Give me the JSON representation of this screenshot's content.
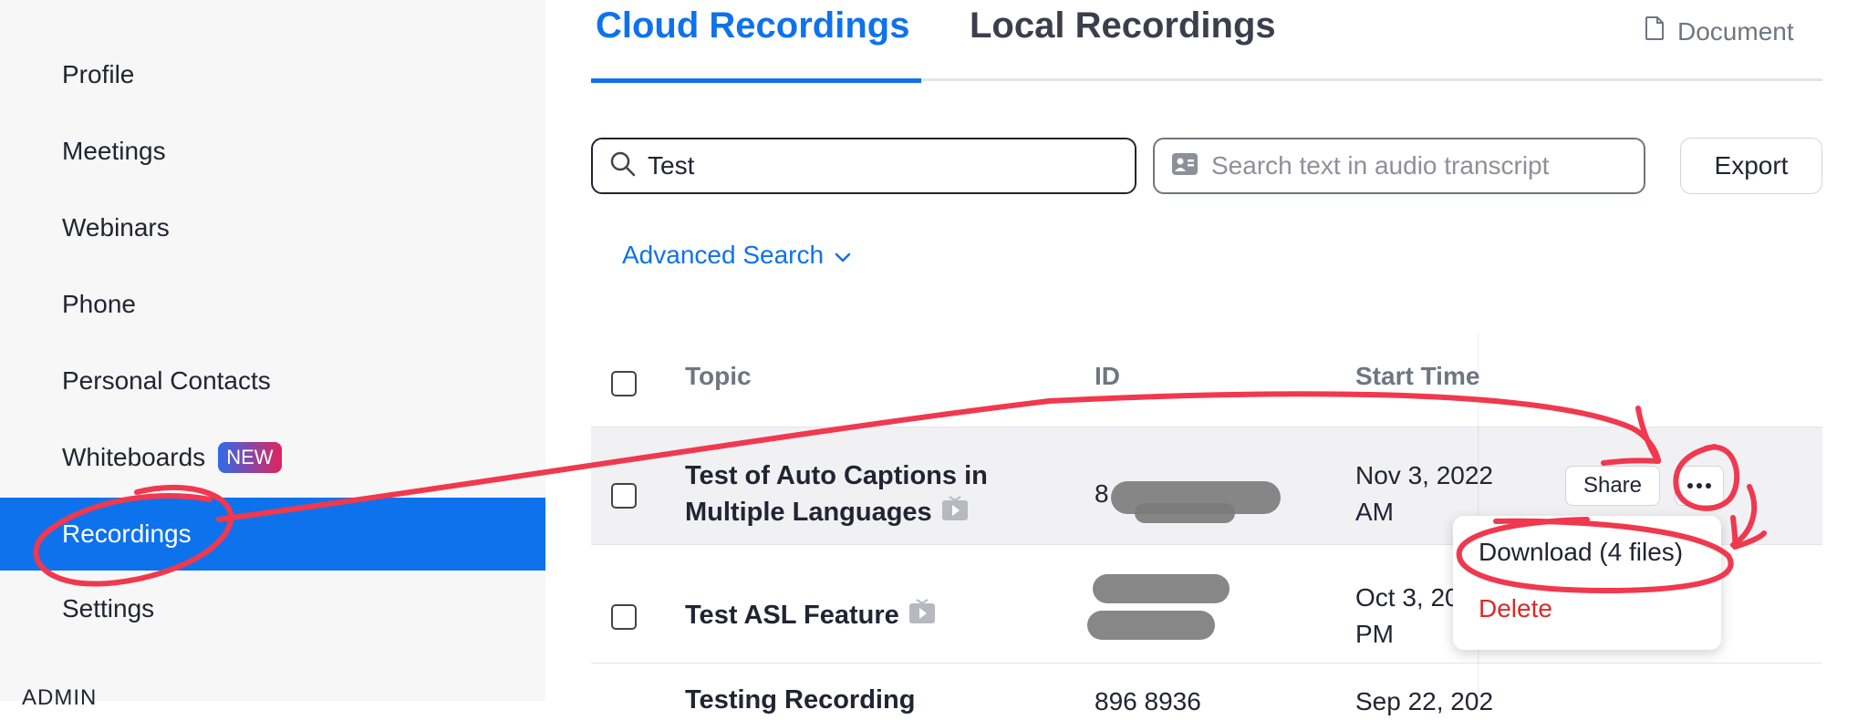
{
  "sidebar": {
    "items": [
      {
        "label": "Profile"
      },
      {
        "label": "Meetings"
      },
      {
        "label": "Webinars"
      },
      {
        "label": "Phone"
      },
      {
        "label": "Personal Contacts"
      },
      {
        "label": "Whiteboards",
        "badge": "NEW"
      },
      {
        "label": "Recordings",
        "active": true
      },
      {
        "label": "Settings"
      }
    ],
    "section_label": "ADMIN"
  },
  "tabs": [
    {
      "label": "Cloud Recordings",
      "active": true
    },
    {
      "label": "Local Recordings"
    }
  ],
  "document_link": "Document",
  "search": {
    "value": "Test",
    "transcript_placeholder": "Search text in audio transcript"
  },
  "export_label": "Export",
  "advanced_search_label": "Advanced Search",
  "table": {
    "columns": [
      "Topic",
      "ID",
      "Start Time"
    ],
    "rows": [
      {
        "topic_line1": "Test of Auto Captions in",
        "topic_line2": "Multiple Languages",
        "id_visible": "8",
        "start_line1": "Nov 3, 2022",
        "start_line2": "AM"
      },
      {
        "topic_line1": "Test ASL Feature",
        "start_line1": "Oct 3, 202",
        "start_line2": "PM"
      },
      {
        "topic_line1": "Testing Recording",
        "id_visible": "896 8936",
        "start_line1": "Sep 22, 202"
      }
    ]
  },
  "row_actions": {
    "share_label": "Share",
    "menu_items": {
      "download": "Download (4 files)",
      "delete": "Delete"
    }
  },
  "colors": {
    "accent": "#0e72ed",
    "danger": "#de2828",
    "annotation": "#f0384f"
  }
}
